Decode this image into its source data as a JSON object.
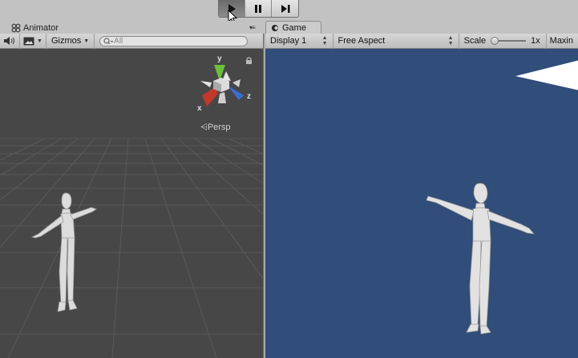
{
  "toolbar": {
    "play_icon": "play-icon",
    "pause_icon": "pause-icon",
    "step_icon": "step-icon"
  },
  "tabs": {
    "animator_label": "Animator",
    "game_label": "Game"
  },
  "scene_toolbar": {
    "audio_icon": "speaker-icon",
    "image_icon": "image-icon",
    "gizmos_label": "Gizmos",
    "search_placeholder": "All"
  },
  "scene_gizmo": {
    "y_label": "y",
    "x_label": "x",
    "z_label": "z",
    "projection_label": "Persp"
  },
  "game_toolbar": {
    "display_label": "Display 1",
    "aspect_label": "Free Aspect",
    "scale_label": "Scale",
    "scale_value": "1x",
    "maximize_label": "Maxin"
  },
  "colors": {
    "scene_bg": "#474747",
    "game_bg": "#314d79",
    "axis_x": "#c0392b",
    "axis_y": "#6bbf3a",
    "axis_z": "#3b6fd4"
  }
}
